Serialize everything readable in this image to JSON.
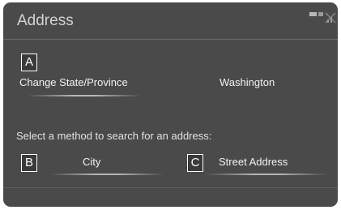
{
  "header": {
    "title": "Address",
    "status_icon": "signal-status-icon"
  },
  "state_row": {
    "callout": "A",
    "button_label": "Change State/Province",
    "current_value": "Washington"
  },
  "search": {
    "prompt": "Select a method to search for an address:",
    "options": [
      {
        "callout": "B",
        "label": "City"
      },
      {
        "callout": "C",
        "label": "Street Address"
      }
    ]
  },
  "colors": {
    "screen_bg": "#4a4a4a",
    "text": "#f2f2f2",
    "title_text": "#d2d2d2",
    "underline": "#b6b6b6"
  }
}
